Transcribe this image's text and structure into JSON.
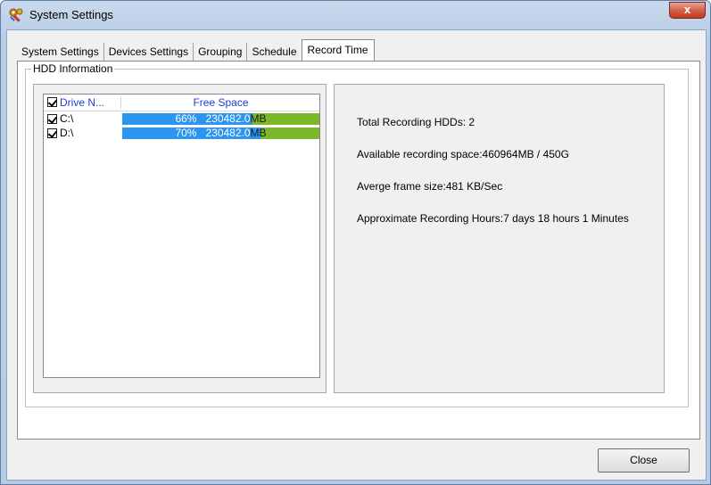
{
  "window": {
    "title": "System Settings",
    "title_icon": "settings-tools-icon",
    "close_glyph": "x",
    "accent_close": "#c1391c"
  },
  "tabs": [
    {
      "label": "System Settings",
      "active": false
    },
    {
      "label": "Devices Settings",
      "active": false
    },
    {
      "label": "Grouping",
      "active": false
    },
    {
      "label": "Schedule",
      "active": false
    },
    {
      "label": "Record Time",
      "active": true
    }
  ],
  "hdd": {
    "group_label": "HDD Information",
    "columns": [
      "Drive N...",
      "Free Space"
    ],
    "header_checked": true,
    "drives": [
      {
        "name": "C:\\",
        "checked": true,
        "percent_text": "66%",
        "percent": 66,
        "free_value": "230482.0",
        "unit": "MB"
      },
      {
        "name": "D:\\",
        "checked": true,
        "percent_text": "70%",
        "percent": 70,
        "free_value": "230482.0",
        "unit": "MB"
      }
    ],
    "bar_colors": {
      "used": "#2b95f0",
      "free": "#7ab82a"
    }
  },
  "info": {
    "total_hdds": "Total Recording HDDs: 2",
    "available_space": "Available recording space:460964MB / 450G",
    "frame_size": "Averge frame size:481 KB/Sec",
    "recording_hours": "Approximate Recording Hours:7 days 18 hours  1 Minutes"
  },
  "footer": {
    "close_label": "Close"
  }
}
